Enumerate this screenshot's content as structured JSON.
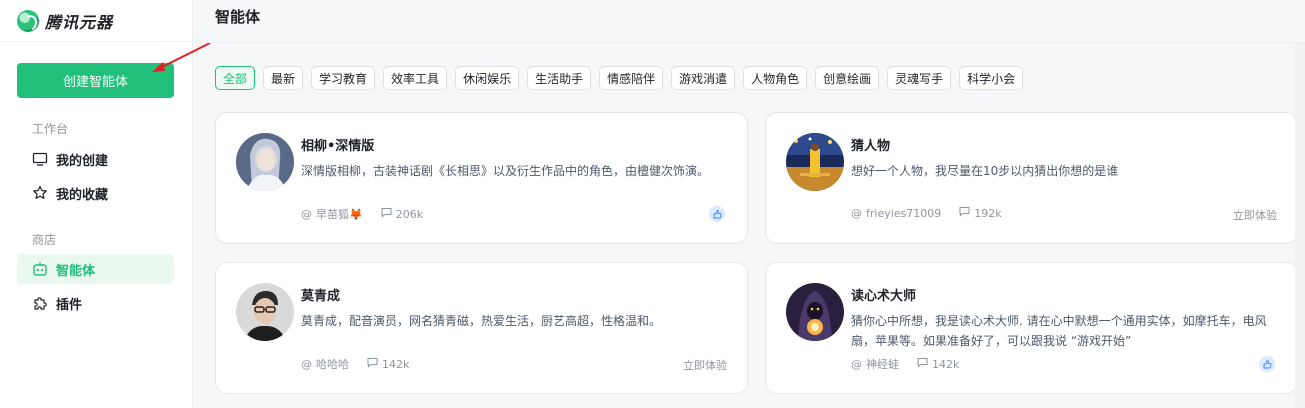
{
  "app": {
    "name": "腾讯元器"
  },
  "sidebar": {
    "create_label": "创建智能体",
    "workspace_label": "工作台",
    "workspace_items": [
      {
        "label": "我的创建",
        "icon": "monitor-icon"
      },
      {
        "label": "我的收藏",
        "icon": "star-icon"
      }
    ],
    "store_label": "商店",
    "store_items": [
      {
        "label": "智能体",
        "icon": "robot-icon",
        "active": true
      },
      {
        "label": "插件",
        "icon": "puzzle-icon",
        "active": false
      }
    ]
  },
  "main": {
    "title": "智能体",
    "filters": [
      "全部",
      "最新",
      "学习教育",
      "效率工具",
      "休闲娱乐",
      "生活助手",
      "情感陪伴",
      "游戏消遣",
      "人物角色",
      "创意绘画",
      "灵魂写手",
      "科学小会"
    ],
    "active_filter": "全部",
    "cards": [
      {
        "name": "相柳•深情版",
        "desc": "深情版相柳，古装神话剧《长相思》以及衍生作品中的角色，由檀健次饰演。",
        "author": "早苗狐🦊",
        "count": "206k",
        "action": "",
        "show_badge": true
      },
      {
        "name": "猜人物",
        "desc": "想好一个人物，我尽量在10步以内猜出你想的是谁",
        "author": "frieyies71009",
        "count": "192k",
        "action": "立即体验",
        "show_badge": false
      },
      {
        "name": "莫青成",
        "desc": "莫青成，配音演员，网名猜青磁，热爱生活，厨艺高超，性格温和。",
        "author": "哈哈哈",
        "count": "142k",
        "action": "立即体验",
        "show_badge": false
      },
      {
        "name": "读心术大师",
        "desc": "猜你心中所想，我是读心术大师. 请在心中默想一个通用实体，如摩托车，电风扇，苹果等。如果准备好了，可以跟我说 “游戏开始”",
        "author": "神经蛙",
        "count": "142k",
        "action": "",
        "show_badge": true
      }
    ]
  },
  "colors": {
    "accent": "#21c07a",
    "arrow": "#e02020"
  }
}
